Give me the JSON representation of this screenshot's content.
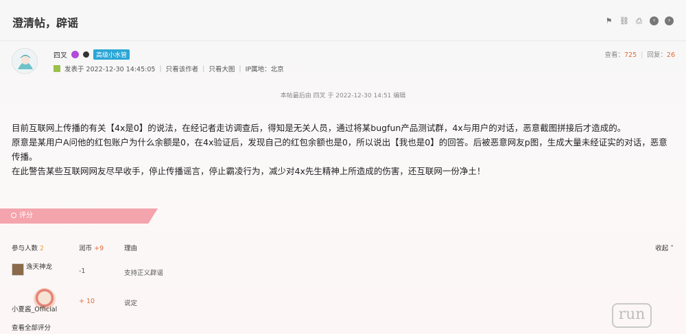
{
  "thread": {
    "title": "澄清帖，辟谣"
  },
  "toolbar": {
    "icons": [
      "report-icon",
      "link-icon",
      "print-icon",
      "prev-icon",
      "next-icon"
    ]
  },
  "author": {
    "name": "四叉",
    "level": "高级小水管",
    "posted": "发表于 2022-12-30 14:45:05",
    "only_author": "只看该作者",
    "large_image": "只看大图",
    "ip": "IP属地：北京"
  },
  "stats": {
    "views_label": "查看：",
    "views": "725",
    "sep": "|",
    "replies_label": "回复：",
    "replies": "26"
  },
  "post": {
    "edit_note": "本帖最后由 四叉 于 2022-12-30 14:51 编辑",
    "paragraphs": [
      "目前互联网上传播的有关【4x是0】的说法，在经记者走访调查后，得知是无关人员，通过将某bugfun产品测试群，4x与用户的对话，恶意截图拼接后才造成的。",
      "原意是某用户A问他的红包账户为什么余额是0，在4x验证后，发现自己的红包余额也是0，所以说出【我也是0】的回答。后被恶意网友p图，生成大量未经证实的对话，恶意传播。",
      "在此警告某些互联网网友尽早收手，停止传播谣言，停止霸凌行为，减少对4x先生精神上所造成的伤害，还互联网一份净土！"
    ]
  },
  "rating": {
    "tab_label": "评分",
    "participants_label": "参与人数",
    "participants": "2",
    "coin_label": "润币",
    "coin_total": "+9",
    "reason_label": "理由",
    "collapse_label": "收起",
    "rows": [
      {
        "user": "逸天神龙",
        "coin": "-1",
        "reason": "支持正义辟谣"
      },
      {
        "user": "小夏酱_Official",
        "coin": "+ 10",
        "reason": "说定"
      }
    ],
    "see_all": "查看全部评分"
  },
  "watermark": "run"
}
